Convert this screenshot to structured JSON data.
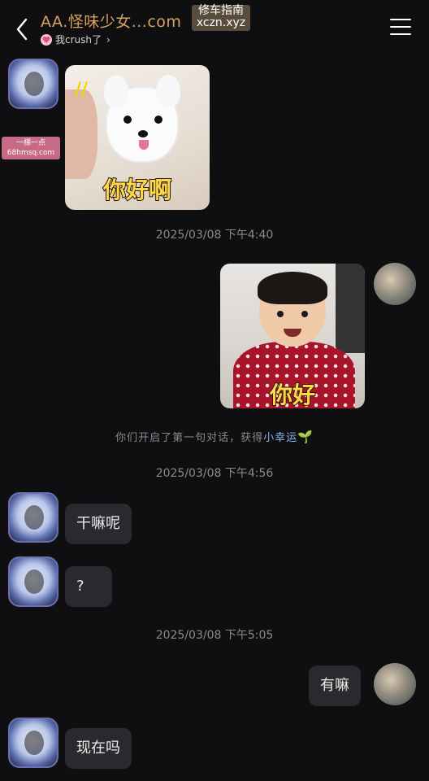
{
  "header": {
    "title": "AA.怪味少女...com",
    "subtitle": "我crush了",
    "watermark": "修车指南 xczn.xyz"
  },
  "badge": "一梯一点 68hmsq.com",
  "messages": {
    "sticker_dog_text": "你好啊",
    "sticker_baby_text": "你好",
    "ts1": "2025/03/08 下午4:40",
    "system_prefix": "你们开启了第一句对话，获得",
    "system_highlight": "小幸运",
    "system_icon": "🌱",
    "ts2": "2025/03/08 下午4:56",
    "msg1": "干嘛呢",
    "msg2": "?",
    "ts3": "2025/03/08 下午5:05",
    "msg3": "有嘛",
    "msg4": "现在吗"
  },
  "colors": {
    "background": "#0f0f12",
    "bubble": "#2a2a2e",
    "title": "#d8a35d",
    "timestamp": "#8a8a8e",
    "highlight": "#8fb4e6"
  }
}
